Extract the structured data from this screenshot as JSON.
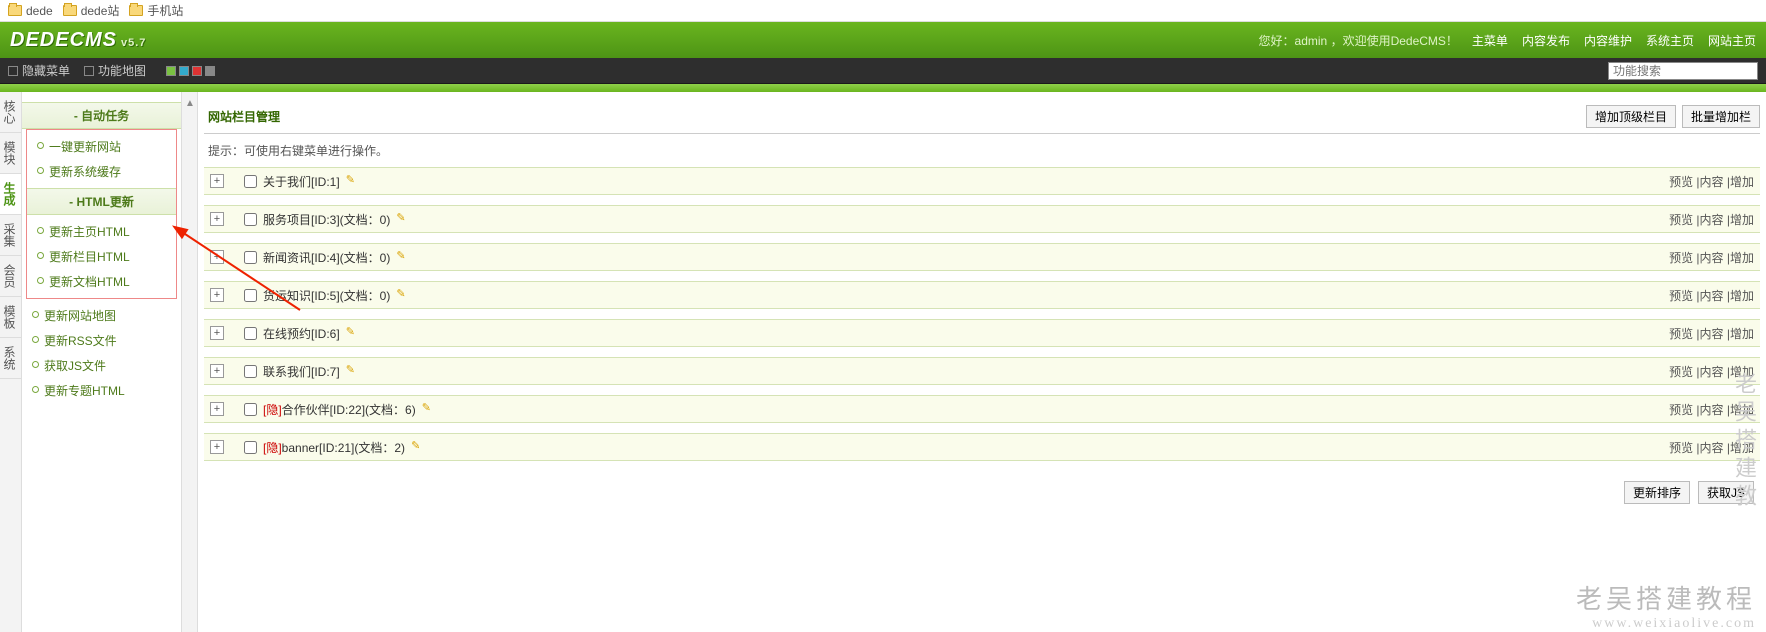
{
  "breadcrumb": [
    "dede",
    "dede站",
    "手机站"
  ],
  "logo": {
    "text": "DEDECMS",
    "ver": "v5.7"
  },
  "header": {
    "welcome": "您好：admin ，欢迎使用DedeCMS！",
    "nav": [
      "主菜单",
      "内容发布",
      "内容维护",
      "系统主页",
      "网站主页"
    ]
  },
  "darkbar": {
    "hide_menu": "隐藏菜单",
    "func_map": "功能地图",
    "search_placeholder": "功能搜索"
  },
  "vert_tabs": [
    "核心",
    "模块",
    "生成",
    "采集",
    "会员",
    "模板",
    "系统"
  ],
  "vert_active": 2,
  "sidebar": {
    "group1_title": "自动任务",
    "group1_items": [
      "一键更新网站",
      "更新系统缓存"
    ],
    "group2_title": "HTML更新",
    "group2_items_boxed": [
      "更新主页HTML",
      "更新栏目HTML",
      "更新文档HTML"
    ],
    "group2_items_rest": [
      "更新网站地图",
      "更新RSS文件",
      "获取JS文件",
      "更新专题HTML"
    ]
  },
  "main": {
    "title": "网站栏目管理",
    "btn_add_top": "增加顶级栏目",
    "btn_batch_add": "批量增加栏",
    "hint": "提示：可使用右键菜单进行操作。",
    "rows": [
      {
        "hidden": false,
        "text": "关于我们[ID:1]",
        "doc": ""
      },
      {
        "hidden": false,
        "text": "服务项目[ID:3]",
        "doc": "(文档：0)"
      },
      {
        "hidden": false,
        "text": "新闻资讯[ID:4]",
        "doc": "(文档：0)"
      },
      {
        "hidden": false,
        "text": "货运知识[ID:5]",
        "doc": "(文档：0)"
      },
      {
        "hidden": false,
        "text": "在线预约[ID:6]",
        "doc": ""
      },
      {
        "hidden": false,
        "text": "联系我们[ID:7]",
        "doc": ""
      },
      {
        "hidden": true,
        "text": "合作伙伴[ID:22]",
        "doc": "(文档：6)"
      },
      {
        "hidden": true,
        "text": "banner[ID:21]",
        "doc": "(文档：2)"
      }
    ],
    "row_actions": "预览 |内容 |增加",
    "hidden_tag": "[隐]",
    "btn_update_sort": "更新排序",
    "btn_get_js": "获取JS"
  },
  "watermark": {
    "vert": "老吴搭建教",
    "big": "老吴搭建教程",
    "url": "www.weixiaolive.com"
  }
}
